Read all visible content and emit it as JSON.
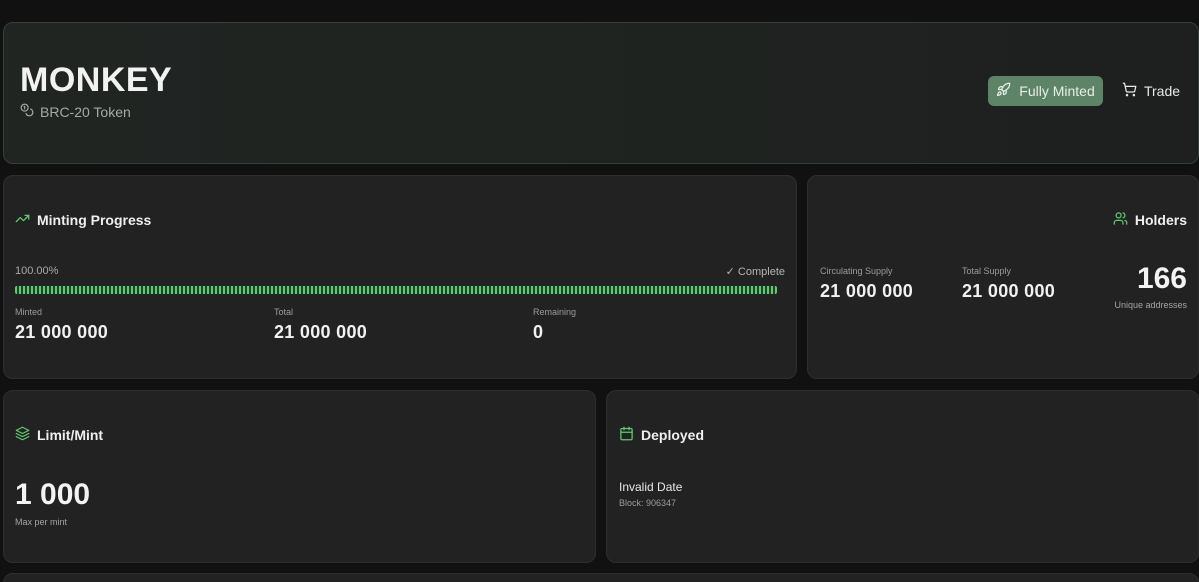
{
  "header": {
    "token_name": "MONKEY",
    "token_type": "BRC-20 Token",
    "status_button": "Fully Minted",
    "trade_button": "Trade",
    "status_icon": "rocket-icon",
    "trade_icon": "cart-icon",
    "type_icon": "coins-icon"
  },
  "minting": {
    "title": "Minting Progress",
    "icon": "trending-up-icon",
    "percent_text": "100.00%",
    "progress": 1.0,
    "status": "✓ Complete",
    "minted_label": "Minted",
    "minted_value": "21 000 000",
    "total_label": "Total",
    "total_value": "21 000 000",
    "remaining_label": "Remaining",
    "remaining_value": "0"
  },
  "holders": {
    "title": "Holders",
    "icon": "users-icon",
    "circulating_label": "Circulating Supply",
    "circulating_value": "21 000 000",
    "total_supply_label": "Total Supply",
    "total_supply_value": "21 000 000",
    "count": "166",
    "count_label": "Unique addresses"
  },
  "limit": {
    "title": "Limit/Mint",
    "icon": "layers-icon",
    "value": "1 000",
    "sublabel": "Max per mint"
  },
  "deployed": {
    "title": "Deployed",
    "icon": "calendar-icon",
    "date": "Invalid Date",
    "block": "Block: 906347"
  },
  "colors": {
    "accent_green": "#5fcb6f",
    "button_green": "#5d8466",
    "card_bg": "#222222",
    "page_bg": "#111111"
  }
}
